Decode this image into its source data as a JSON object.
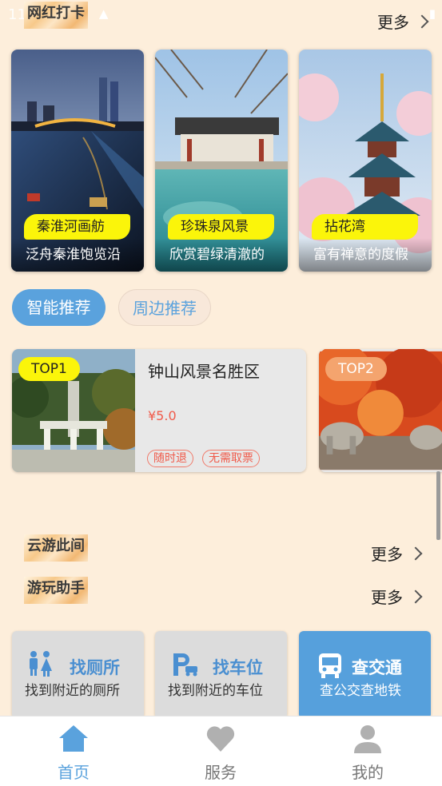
{
  "status_bar": {
    "time": "11:53"
  },
  "hot_spots": {
    "title": "网红打卡",
    "more_label": "更多",
    "items": [
      {
        "name": "秦淮河画舫",
        "desc": "泛舟秦淮饱览沿"
      },
      {
        "name": "珍珠泉风景",
        "desc": "欣赏碧绿清澈的"
      },
      {
        "name": "拈花湾",
        "desc": "富有禅意的度假"
      }
    ]
  },
  "rec_tabs": [
    {
      "label": "智能推荐",
      "active": true
    },
    {
      "label": "周边推荐",
      "active": false
    }
  ],
  "recommendations": [
    {
      "rank": "TOP1",
      "title": "钟山风景名胜区",
      "price": "¥5.0",
      "tags": [
        "随时退",
        "无需取票"
      ]
    },
    {
      "rank": "TOP2"
    }
  ],
  "sections": {
    "cloud_tour": {
      "title": "云游此间",
      "more_label": "更多"
    },
    "helper": {
      "title": "游玩助手",
      "more_label": "更多"
    }
  },
  "tools": [
    {
      "title": "找厕所",
      "sub": "找到附近的厕所",
      "icon": "restroom-icon"
    },
    {
      "title": "找车位",
      "sub": "找到附近的车位",
      "icon": "parking-icon"
    },
    {
      "title": "查交通",
      "sub": "查公交查地铁",
      "icon": "bus-icon"
    }
  ],
  "tabbar": [
    {
      "label": "首页",
      "icon": "home-icon",
      "active": true
    },
    {
      "label": "服务",
      "icon": "heart-icon",
      "active": false
    },
    {
      "label": "我的",
      "icon": "user-icon",
      "active": false
    }
  ],
  "colors": {
    "accent": "#5aa2dd",
    "background": "#fdeedb",
    "badge_yellow": "#fbf50a",
    "price_red": "#f05a4a",
    "rank2": "#f4a46e"
  }
}
